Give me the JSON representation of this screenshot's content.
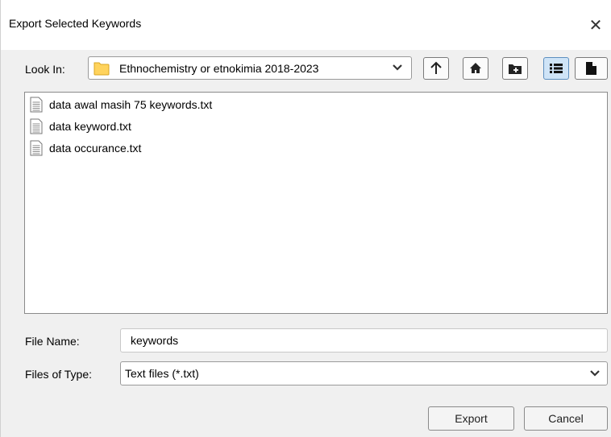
{
  "window": {
    "title": "Export Selected Keywords",
    "close_glyph": "✕"
  },
  "look_in": {
    "label": "Look In:",
    "value": "Ethnochemistry or etnokimia 2018-2023",
    "icon": "folder-icon"
  },
  "toolbar": {
    "buttons": [
      {
        "name": "up-one-level-button",
        "icon": "arrow-up-icon"
      },
      {
        "name": "home-button",
        "icon": "home-icon"
      },
      {
        "name": "new-folder-button",
        "icon": "new-folder-icon"
      },
      {
        "name": "list-view-button",
        "icon": "list-icon",
        "active": true
      },
      {
        "name": "details-view-button",
        "icon": "document-icon"
      }
    ]
  },
  "files": [
    {
      "name": "data awal masih 75 keywords.txt",
      "icon": "text-file-icon"
    },
    {
      "name": "data keyword.txt",
      "icon": "text-file-icon"
    },
    {
      "name": "data occurance.txt",
      "icon": "text-file-icon"
    }
  ],
  "file_name": {
    "label": "File Name:",
    "value": "keywords"
  },
  "file_type": {
    "label": "Files of Type:",
    "value": "Text files (*.txt)"
  },
  "actions": {
    "export_label": "Export",
    "cancel_label": "Cancel"
  },
  "colors": {
    "dialog_bg": "#f0f0f0",
    "folder": "#ffd35c",
    "active_toggle": "#cfe4f7"
  }
}
